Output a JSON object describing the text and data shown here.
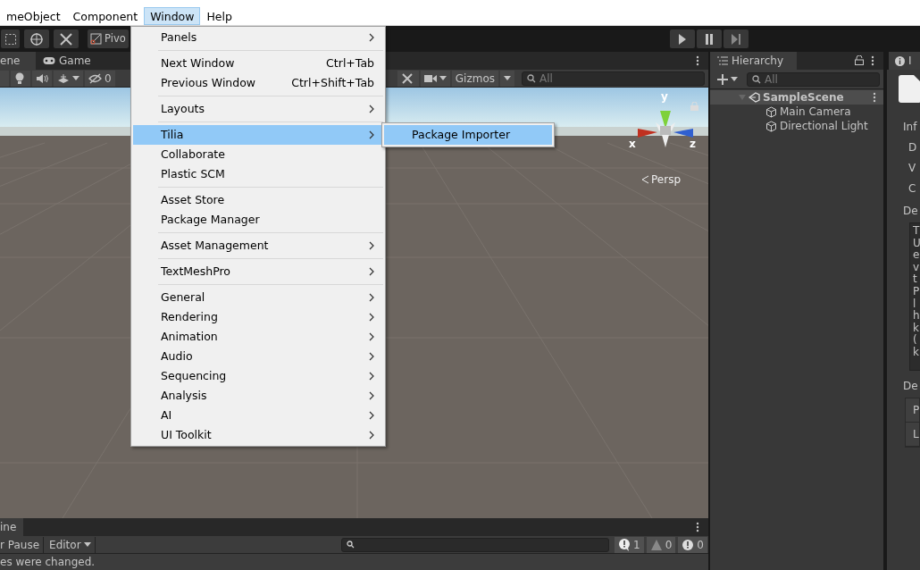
{
  "menu_bar": [
    {
      "label": "meObject",
      "selected": false
    },
    {
      "label": "Component",
      "selected": false
    },
    {
      "label": "Window",
      "selected": true
    },
    {
      "label": "Help",
      "selected": false
    }
  ],
  "toolbar": {
    "pivot_button": "Pivo"
  },
  "scene_view": {
    "tabs": [
      {
        "label": "ene",
        "selected": true
      },
      {
        "label": "Game",
        "selected": false
      }
    ],
    "hidden_count": "0",
    "gizmos_button": "Gizmos",
    "search_placeholder": "All",
    "axis_labels": [
      "y",
      "x",
      "z"
    ],
    "camera_label": "Persp"
  },
  "window_menu": {
    "items": [
      {
        "kind": "item",
        "label": "Panels",
        "submenu": true,
        "selected": false
      },
      {
        "kind": "separator"
      },
      {
        "kind": "item",
        "label": "Next Window",
        "shortcut": "Ctrl+Tab",
        "submenu": false,
        "selected": false
      },
      {
        "kind": "item",
        "label": "Previous Window",
        "shortcut": "Ctrl+Shift+Tab",
        "submenu": false,
        "selected": false
      },
      {
        "kind": "separator"
      },
      {
        "kind": "item",
        "label": "Layouts",
        "submenu": true,
        "selected": false
      },
      {
        "kind": "separator"
      },
      {
        "kind": "item",
        "label": "Tilia",
        "submenu": true,
        "selected": true
      },
      {
        "kind": "item",
        "label": "Collaborate",
        "submenu": false,
        "selected": false
      },
      {
        "kind": "item",
        "label": "Plastic SCM",
        "submenu": false,
        "selected": false
      },
      {
        "kind": "separator"
      },
      {
        "kind": "item",
        "label": "Asset Store",
        "submenu": false,
        "selected": false
      },
      {
        "kind": "item",
        "label": "Package Manager",
        "submenu": false,
        "selected": false
      },
      {
        "kind": "separator"
      },
      {
        "kind": "item",
        "label": "Asset Management",
        "submenu": true,
        "selected": false
      },
      {
        "kind": "separator"
      },
      {
        "kind": "item",
        "label": "TextMeshPro",
        "submenu": true,
        "selected": false
      },
      {
        "kind": "separator"
      },
      {
        "kind": "item",
        "label": "General",
        "submenu": true,
        "selected": false
      },
      {
        "kind": "item",
        "label": "Rendering",
        "submenu": true,
        "selected": false
      },
      {
        "kind": "item",
        "label": "Animation",
        "submenu": true,
        "selected": false
      },
      {
        "kind": "item",
        "label": "Audio",
        "submenu": true,
        "selected": false
      },
      {
        "kind": "item",
        "label": "Sequencing",
        "submenu": true,
        "selected": false
      },
      {
        "kind": "item",
        "label": "Analysis",
        "submenu": true,
        "selected": false
      },
      {
        "kind": "item",
        "label": "AI",
        "submenu": true,
        "selected": false
      },
      {
        "kind": "item",
        "label": "UI Toolkit",
        "submenu": true,
        "selected": false
      }
    ]
  },
  "submenu": {
    "items": [
      {
        "label": "Package Importer",
        "selected": true
      }
    ]
  },
  "hierarchy": {
    "title": "Hierarchy",
    "search_placeholder": "All",
    "tree": [
      {
        "label": "SampleScene",
        "expanded": true,
        "selected": true,
        "children": [
          {
            "label": "Main Camera",
            "selected": false
          },
          {
            "label": "Directional Light",
            "selected": false
          }
        ]
      }
    ]
  },
  "inspector": {
    "tab": "I",
    "section_label": "Inf",
    "field_labels": [
      "D",
      "V",
      "C"
    ],
    "description_label": "De",
    "description_lines": [
      "T",
      "U",
      "e",
      "v",
      "t",
      "P",
      "l",
      "h",
      "k",
      "(",
      "k"
    ],
    "dependencies_label": "De",
    "table_rows": [
      "P",
      "L"
    ]
  },
  "console": {
    "tab": "ine",
    "pause_button": "r Pause",
    "editor_button": "Editor",
    "counts": [
      "1",
      "0",
      "0"
    ],
    "message": "es were changed."
  }
}
